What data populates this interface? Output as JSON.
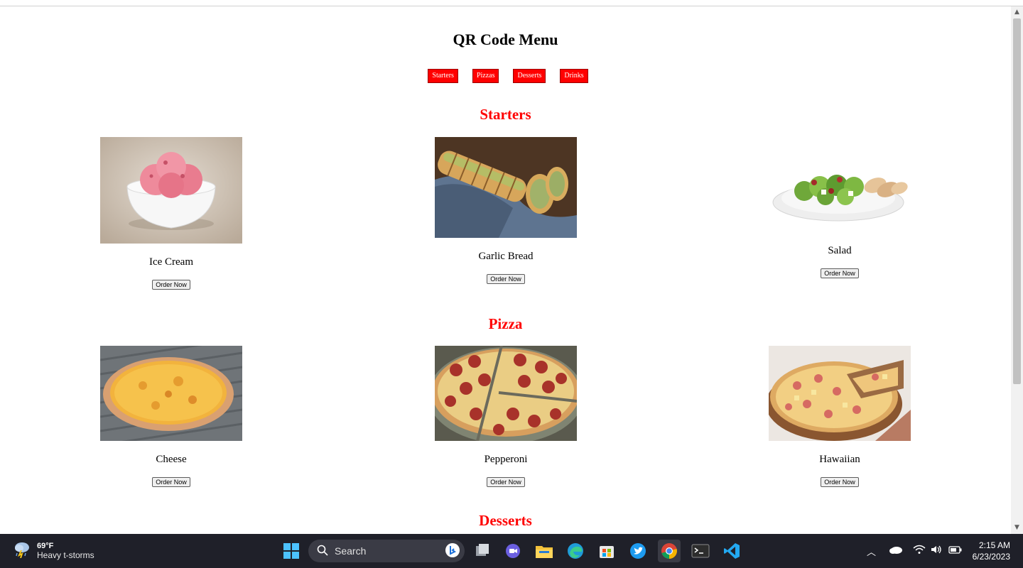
{
  "page": {
    "title": "QR Code Menu",
    "nav": [
      "Starters",
      "Pizzas",
      "Desserts",
      "Drinks"
    ]
  },
  "sections": [
    {
      "title": "Starters",
      "items": [
        {
          "name": "Ice Cream",
          "button": "Order Now"
        },
        {
          "name": "Garlic Bread",
          "button": "Order Now"
        },
        {
          "name": "Salad",
          "button": "Order Now"
        }
      ]
    },
    {
      "title": "Pizza",
      "items": [
        {
          "name": "Cheese",
          "button": "Order Now"
        },
        {
          "name": "Pepperoni",
          "button": "Order Now"
        },
        {
          "name": "Hawaiian",
          "button": "Order Now"
        }
      ]
    },
    {
      "title": "Desserts",
      "items": []
    }
  ],
  "taskbar": {
    "weather_temp": "69°F",
    "weather_condition": "Heavy t-storms",
    "search_placeholder": "Search",
    "time": "2:15 AM",
    "date": "6/23/2023",
    "icons": [
      "start-icon",
      "search-icon",
      "bing-icon",
      "task-view-icon",
      "meet-icon",
      "file-explorer-icon",
      "edge-icon",
      "store-icon",
      "twitter-icon",
      "chrome-icon",
      "terminal-icon",
      "vscode-icon"
    ]
  },
  "colors": {
    "accent": "#ff0000",
    "taskbar": "#1f2029"
  }
}
